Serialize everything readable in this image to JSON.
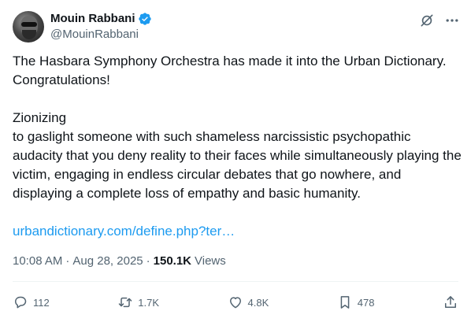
{
  "author": {
    "display_name": "Mouin Rabbani",
    "handle": "@MouinRabbani"
  },
  "icons": {
    "verified": "verified-badge-icon",
    "grok": "grok-icon",
    "more": "more-icon",
    "reply": "reply-icon",
    "repost": "repost-icon",
    "like": "like-icon",
    "bookmark": "bookmark-icon",
    "share": "share-icon"
  },
  "colors": {
    "verified": "#1d9bf0",
    "link": "#1d9bf0",
    "secondary_text": "#536471"
  },
  "tweet": {
    "line1": "The Hasbara Symphony Orchestra has made it into the Urban Dictionary.",
    "line2": "Congratulations!",
    "term": "Zionizing",
    "definition": "to gaslight someone with such shameless narcissistic psychopathic audacity that you deny reality to their faces while simultaneously playing the victim, engaging in endless circular debates that go nowhere, and displaying a complete loss of empathy and basic humanity.",
    "link_text": "urbandictionary.com/define.php?ter…"
  },
  "meta": {
    "time": "10:08 AM",
    "dot": "·",
    "date": "Aug 28, 2025",
    "views_count": "150.1K",
    "views_label": "Views"
  },
  "stats": {
    "replies": "112",
    "reposts": "1.7K",
    "likes": "4.8K",
    "bookmarks": "478"
  }
}
